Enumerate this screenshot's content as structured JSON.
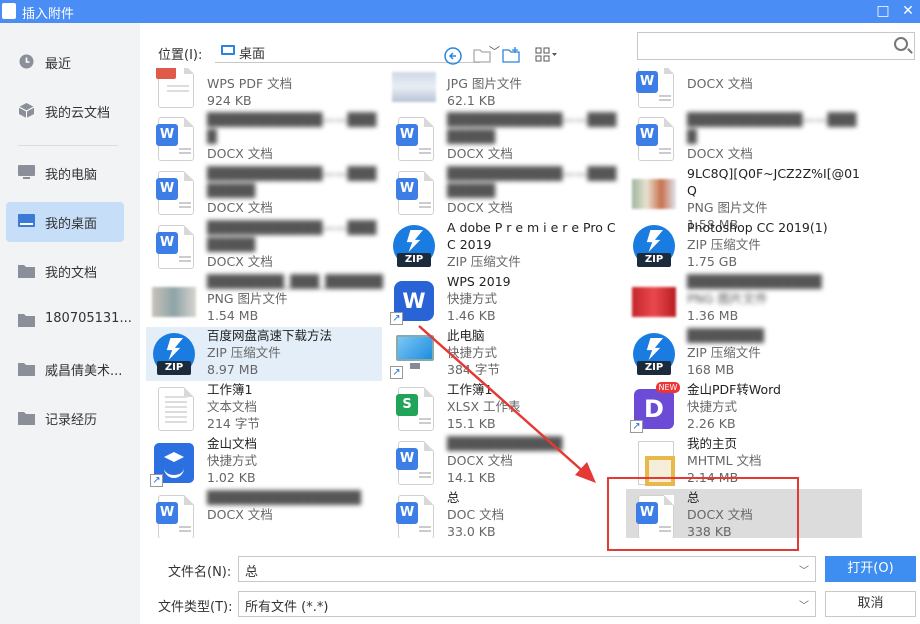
{
  "window": {
    "title": "插入附件",
    "maximize": "□",
    "close": "✕"
  },
  "sidebar": {
    "items": [
      {
        "label": "最近",
        "icon": "clock-icon"
      },
      {
        "label": "我的云文档",
        "icon": "cloud-box-icon"
      },
      {
        "label": "我的电脑",
        "icon": "computer-icon"
      },
      {
        "label": "我的桌面",
        "icon": "desktop-icon",
        "active": true
      },
      {
        "label": "我的文档",
        "icon": "folder-icon"
      },
      {
        "label": "180705131...",
        "icon": "folder-icon"
      },
      {
        "label": "威昌倩美术...",
        "icon": "folder-icon"
      },
      {
        "label": "记录经历",
        "icon": "folder-icon"
      }
    ]
  },
  "toolbar": {
    "location_label": "位置(I):",
    "location_value": "桌面",
    "back_icon": "back-arrow-icon",
    "up_icon": "folder-up-icon",
    "new_folder_icon": "new-folder-icon",
    "view_icon": "grid-view-icon",
    "search_placeholder": ""
  },
  "files": [
    {
      "name": "",
      "type": "WPS PDF 文档",
      "size": "924 KB",
      "icon": "pdf"
    },
    {
      "name": "",
      "type": "JPG 图片文件",
      "size": "62.1 KB",
      "icon": "image",
      "type_blur": false
    },
    {
      "name": "",
      "type": "DOCX 文档",
      "size": "",
      "icon": "word"
    },
    {
      "name": "████████████——████",
      "type": "DOCX 文档",
      "size": "",
      "icon": "word",
      "blur": true
    },
    {
      "name": "████████████——████████",
      "type": "DOCX 文档",
      "size": "",
      "icon": "word",
      "blur": true
    },
    {
      "name": "████████████——████",
      "type": "DOCX 文档",
      "size": "",
      "icon": "word",
      "blur": true
    },
    {
      "name": "████████████——████████",
      "type": "DOCX 文档",
      "size": "",
      "icon": "word",
      "blur": true
    },
    {
      "name": "████████████——████████",
      "type": "DOCX 文档",
      "size": "",
      "icon": "word",
      "blur": true
    },
    {
      "name": "9LC8Q][Q0F~JCZ2Z%I[@01Q",
      "type": "PNG 图片文件",
      "size": "1.58 MB",
      "icon": "image"
    },
    {
      "name": "████████████——████████",
      "type": "DOCX 文档",
      "size": "",
      "icon": "word",
      "blur": true
    },
    {
      "name": "A dobe P r e m i e r e Pro CC 2019",
      "type": "ZIP 压缩文件",
      "size": "",
      "icon": "zip"
    },
    {
      "name": "Photoshop CC 2019(1)",
      "type": "ZIP 压缩文件",
      "size": "1.75 GB",
      "icon": "zip"
    },
    {
      "name": "████████_███_██████",
      "type": "PNG 图片文件",
      "size": "1.54 MB",
      "icon": "image"
    },
    {
      "name": "WPS 2019",
      "type": "快捷方式",
      "size": "1.46 KB",
      "icon": "wps"
    },
    {
      "name": "██████████████",
      "type": "PNG 图片文件",
      "size": "1.36 MB",
      "icon": "image"
    },
    {
      "name": "百度网盘高速下载方法",
      "type": "ZIP 压缩文件",
      "size": "8.97 MB",
      "icon": "zip"
    },
    {
      "name": "此电脑",
      "type": "快捷方式",
      "size": "384 字节",
      "icon": "pc"
    },
    {
      "name": "████████",
      "type": "ZIP 压缩文件",
      "size": "168 MB",
      "icon": "zip"
    },
    {
      "name": "工作簿1",
      "type": "文本文档",
      "size": "214 字节",
      "icon": "text"
    },
    {
      "name": "工作簿1",
      "type": "XLSX 工作表",
      "size": "15.1 KB",
      "icon": "xlsx"
    },
    {
      "name": "金山PDF转Word",
      "type": "快捷方式",
      "size": "2.26 KB",
      "icon": "pdfword"
    },
    {
      "name": "金山文档",
      "type": "快捷方式",
      "size": "1.02 KB",
      "icon": "jinshan"
    },
    {
      "name": "████████████",
      "type": "DOCX 文档",
      "size": "14.1 KB",
      "icon": "word"
    },
    {
      "name": "我的主页",
      "type": "MHTML 文档",
      "size": "2.14 MB",
      "icon": "mhtml"
    },
    {
      "name": "████████████████",
      "type": "DOCX 文档",
      "size": "",
      "icon": "word"
    },
    {
      "name": "总",
      "type": "DOC 文档",
      "size": "33.0 KB",
      "icon": "word"
    },
    {
      "name": "总",
      "type": "DOCX 文档",
      "size": "338 KB",
      "icon": "word"
    }
  ],
  "bottom": {
    "filename_label": "文件名(N):",
    "filename_value": "总",
    "filetype_label": "文件类型(T):",
    "filetype_value": "所有文件 (*.*)",
    "open_label": "打开(O)",
    "cancel_label": "取消"
  },
  "colors": {
    "accent": "#4a8ef5",
    "annotation": "#e53935",
    "selected": "#dcdcdc"
  }
}
